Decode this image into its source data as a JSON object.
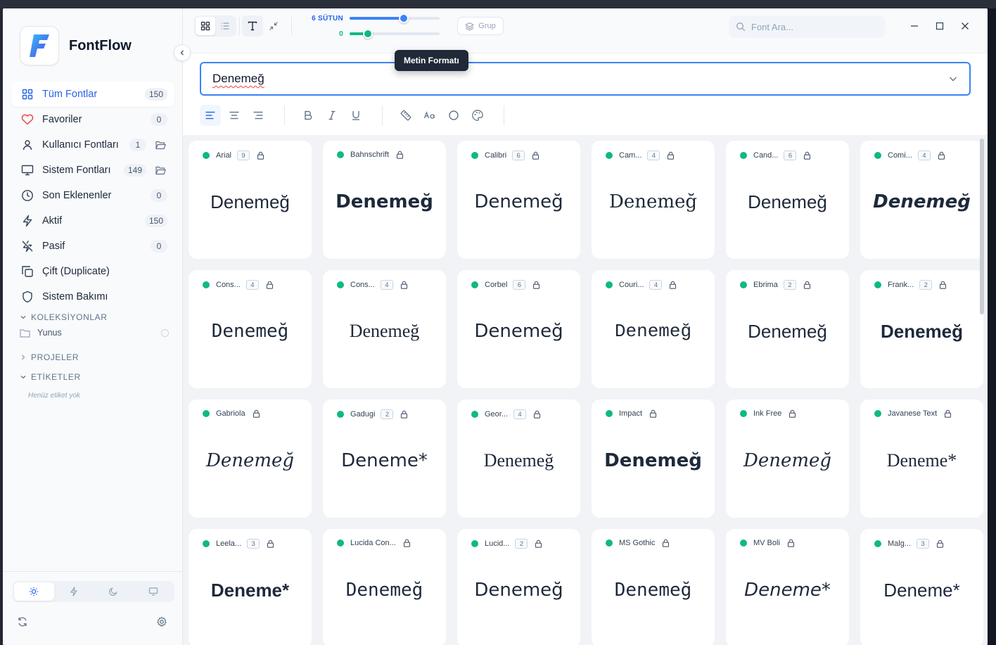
{
  "app": {
    "name": "FontFlow"
  },
  "sidebar": {
    "items": [
      {
        "label": "Tüm Fontlar",
        "count": "150",
        "icon": "grid-icon",
        "active": true,
        "folder": false
      },
      {
        "label": "Favoriler",
        "count": "0",
        "icon": "heart-icon",
        "active": false,
        "folder": false
      },
      {
        "label": "Kullanıcı Fontları",
        "count": "1",
        "icon": "user-icon",
        "active": false,
        "folder": true
      },
      {
        "label": "Sistem Fontları",
        "count": "149",
        "icon": "monitor-icon",
        "active": false,
        "folder": true
      },
      {
        "label": "Son Eklenenler",
        "count": "0",
        "icon": "clock-icon",
        "active": false,
        "folder": false
      },
      {
        "label": "Aktif",
        "count": "150",
        "icon": "zap-icon",
        "active": false,
        "folder": false
      },
      {
        "label": "Pasif",
        "count": "0",
        "icon": "zap-off-icon",
        "active": false,
        "folder": false
      },
      {
        "label": "Çift (Duplicate)",
        "count": "",
        "icon": "copy-icon",
        "active": false,
        "folder": false
      },
      {
        "label": "Sistem Bakımı",
        "count": "",
        "icon": "shield-icon",
        "active": false,
        "folder": false
      }
    ],
    "collections_label": "KOLEKSİYONLAR",
    "collections": [
      {
        "label": "Yunus"
      }
    ],
    "projects_label": "PROJELER",
    "tags_label": "ETİKETLER",
    "no_tags": "Henüz etiket yok"
  },
  "toolbar": {
    "columns_label": "6 SÜTUN",
    "columns_value": 0.6,
    "second_label": "0",
    "second_value": 0.2,
    "group_label": "Grup",
    "search_placeholder": "Font Ara...",
    "tooltip": "Metin Formatı"
  },
  "preview": {
    "text": "Denemeğ"
  },
  "colors": {
    "accent": "#2563eb",
    "active_dot": "#10b981",
    "heart": "#ef4444"
  },
  "fonts": [
    {
      "name": "Arial",
      "count": "9",
      "sample": "Denemeğ",
      "family": "'Liberation Sans', sans-serif",
      "weight": "400",
      "style": "normal"
    },
    {
      "name": "Bahnschrift",
      "count": "",
      "sample": "Denemeğ",
      "family": "'DejaVu Sans', sans-serif",
      "weight": "700",
      "style": "normal"
    },
    {
      "name": "Calibri",
      "count": "6",
      "sample": "Denemeğ",
      "family": "'DejaVu Sans', sans-serif",
      "weight": "400",
      "style": "normal"
    },
    {
      "name": "Cam...",
      "count": "4",
      "sample": "Denemeğ",
      "family": "'DejaVu Serif', serif",
      "weight": "400",
      "style": "normal"
    },
    {
      "name": "Cand...",
      "count": "6",
      "sample": "Denemeğ",
      "family": "'Liberation Sans', sans-serif",
      "weight": "400",
      "style": "normal"
    },
    {
      "name": "Comi...",
      "count": "4",
      "sample": "Denemeğ",
      "family": "'DejaVu Sans', sans-serif",
      "weight": "700",
      "style": "italic"
    },
    {
      "name": "Cons...",
      "count": "4",
      "sample": "Denemeğ",
      "family": "'DejaVu Sans Mono', monospace",
      "weight": "400",
      "style": "normal"
    },
    {
      "name": "Cons...",
      "count": "4",
      "sample": "Denemeğ",
      "family": "'Liberation Serif', serif",
      "weight": "400",
      "style": "normal"
    },
    {
      "name": "Corbel",
      "count": "6",
      "sample": "Denemeğ",
      "family": "'DejaVu Sans', sans-serif",
      "weight": "400",
      "style": "normal"
    },
    {
      "name": "Couri...",
      "count": "4",
      "sample": "Denemeğ",
      "family": "'Liberation Mono', monospace",
      "weight": "400",
      "style": "normal"
    },
    {
      "name": "Ebrima",
      "count": "2",
      "sample": "Denemeğ",
      "family": "'Liberation Sans', sans-serif",
      "weight": "400",
      "style": "normal"
    },
    {
      "name": "Frank...",
      "count": "2",
      "sample": "Denemeğ",
      "family": "'Liberation Sans', sans-serif",
      "weight": "700",
      "style": "normal"
    },
    {
      "name": "Gabriola",
      "count": "",
      "sample": "Denemeğ",
      "family": "'DejaVu Serif', serif",
      "weight": "400",
      "style": "italic"
    },
    {
      "name": "Gadugi",
      "count": "2",
      "sample": "Deneme*",
      "family": "'DejaVu Sans', sans-serif",
      "weight": "400",
      "style": "normal"
    },
    {
      "name": "Geor...",
      "count": "4",
      "sample": "Denemeğ",
      "family": "'Liberation Serif', serif",
      "weight": "400",
      "style": "normal"
    },
    {
      "name": "Impact",
      "count": "",
      "sample": "Denemeğ",
      "family": "'DejaVu Sans', sans-serif",
      "weight": "900",
      "style": "normal"
    },
    {
      "name": "Ink Free",
      "count": "",
      "sample": "Denemeğ",
      "family": "'DejaVu Serif', serif",
      "weight": "300",
      "style": "italic"
    },
    {
      "name": "Javanese Text",
      "count": "",
      "sample": "Deneme*",
      "family": "'Liberation Serif', serif",
      "weight": "400",
      "style": "normal"
    },
    {
      "name": "Leela...",
      "count": "3",
      "sample": "Deneme*",
      "family": "'Liberation Sans', sans-serif",
      "weight": "700",
      "style": "normal"
    },
    {
      "name": "Lucida Con...",
      "count": "",
      "sample": "Denemeğ",
      "family": "'DejaVu Sans Mono', monospace",
      "weight": "400",
      "style": "normal"
    },
    {
      "name": "Lucid...",
      "count": "2",
      "sample": "Denemeğ",
      "family": "'DejaVu Sans', sans-serif",
      "weight": "400",
      "style": "normal"
    },
    {
      "name": "MS Gothic",
      "count": "",
      "sample": "Denemeğ",
      "family": "'DejaVu Sans Mono', monospace",
      "weight": "400",
      "style": "normal"
    },
    {
      "name": "MV Boli",
      "count": "",
      "sample": "Deneme*",
      "family": "'DejaVu Sans', sans-serif",
      "weight": "400",
      "style": "italic"
    },
    {
      "name": "Malg...",
      "count": "3",
      "sample": "Deneme*",
      "family": "'Liberation Sans', sans-serif",
      "weight": "400",
      "style": "normal"
    }
  ]
}
